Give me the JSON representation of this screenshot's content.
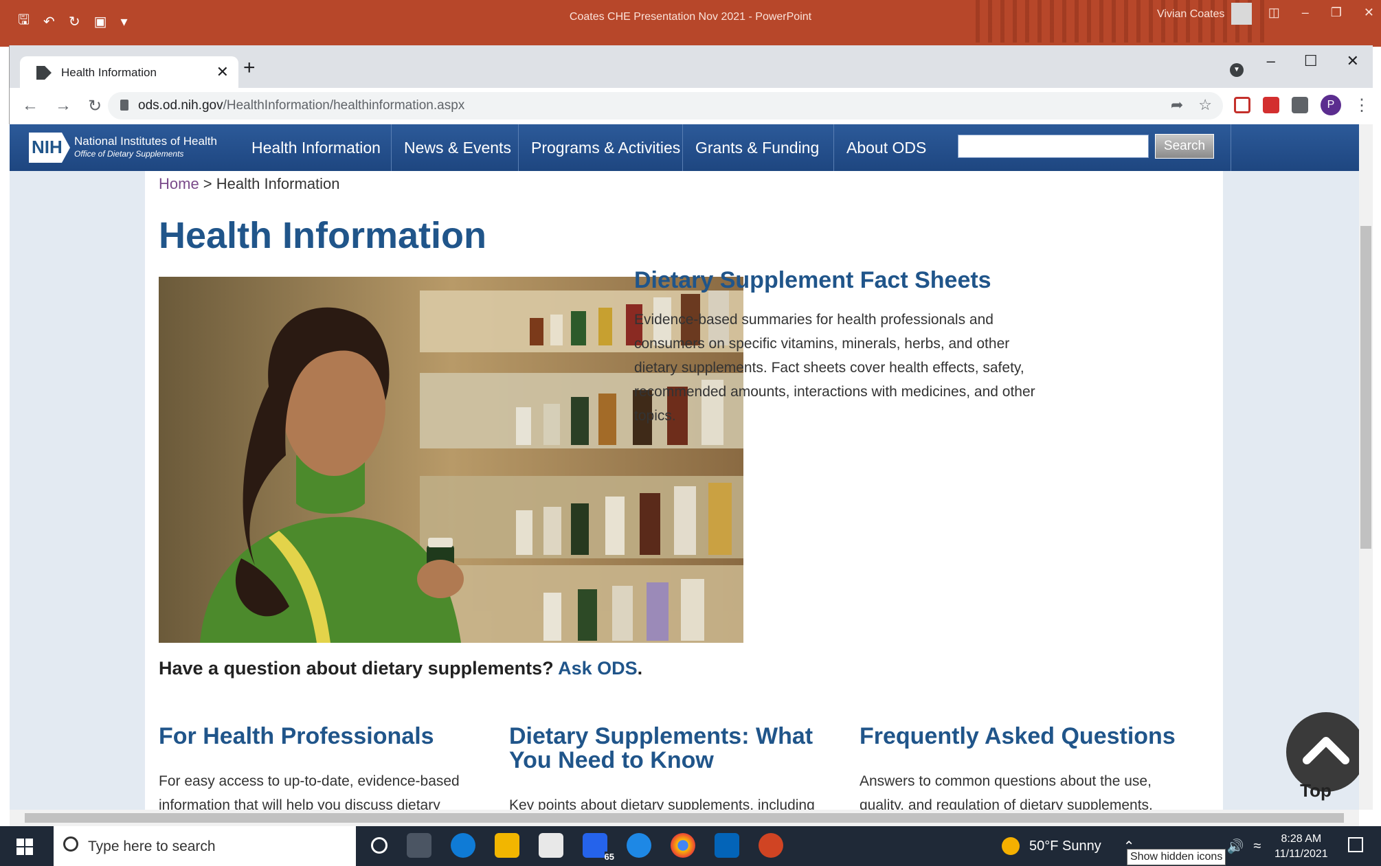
{
  "powerpoint": {
    "title": "Coates CHE Presentation Nov 2021  -  PowerPoint",
    "user": "Vivian Coates",
    "quick_access": [
      "save-icon",
      "undo-icon",
      "redo-icon",
      "present-icon",
      "customize-icon"
    ]
  },
  "browser": {
    "tab_title": "Health Information",
    "new_tab": "+",
    "url_domain": "ods.od.nih.gov",
    "url_path": "/HealthInformation/healthinformation.aspx",
    "profile_initial": "P"
  },
  "site": {
    "logo_text": "NIH",
    "logo_name": "National Institutes of Health",
    "logo_sub": "Office of Dietary Supplements",
    "nav": [
      "Health Information",
      "News & Events",
      "Programs & Activities",
      "Grants & Funding",
      "About ODS"
    ],
    "search_button": "Search",
    "search_value": ""
  },
  "page": {
    "breadcrumb_home": "Home",
    "breadcrumb_sep": " > ",
    "breadcrumb_current": "Health Information",
    "heading": "Health Information",
    "fact_sheets": {
      "title": "Dietary Supplement Fact Sheets",
      "text": "Evidence-based summaries for health professionals and consumers on specific vitamins, minerals, herbs, and other dietary supplements. Fact sheets cover health effects, safety, recommended amounts, interactions with medicines, and other topics."
    },
    "ask_prefix": "Have a question about dietary supplements?",
    "ask_link": "Ask ODS",
    "ask_suffix": ".",
    "columns": [
      {
        "title": "For Health Professionals",
        "text": "For easy access to up-to-date, evidence-based information that will help you discuss dietary"
      },
      {
        "title": "Dietary Supplements: What You Need to Know",
        "text": "Key points about dietary supplements, including"
      },
      {
        "title": "Frequently Asked Questions",
        "text": "Answers to common questions about the use, quality, and regulation of dietary supplements."
      }
    ],
    "top_label": "Top"
  },
  "taskbar": {
    "search_placeholder": "Type here to search",
    "mail_badge": "65",
    "weather": "50°F  Sunny",
    "tooltip": "Show hidden icons",
    "time": "8:28 AM",
    "date": "11/11/2021"
  }
}
